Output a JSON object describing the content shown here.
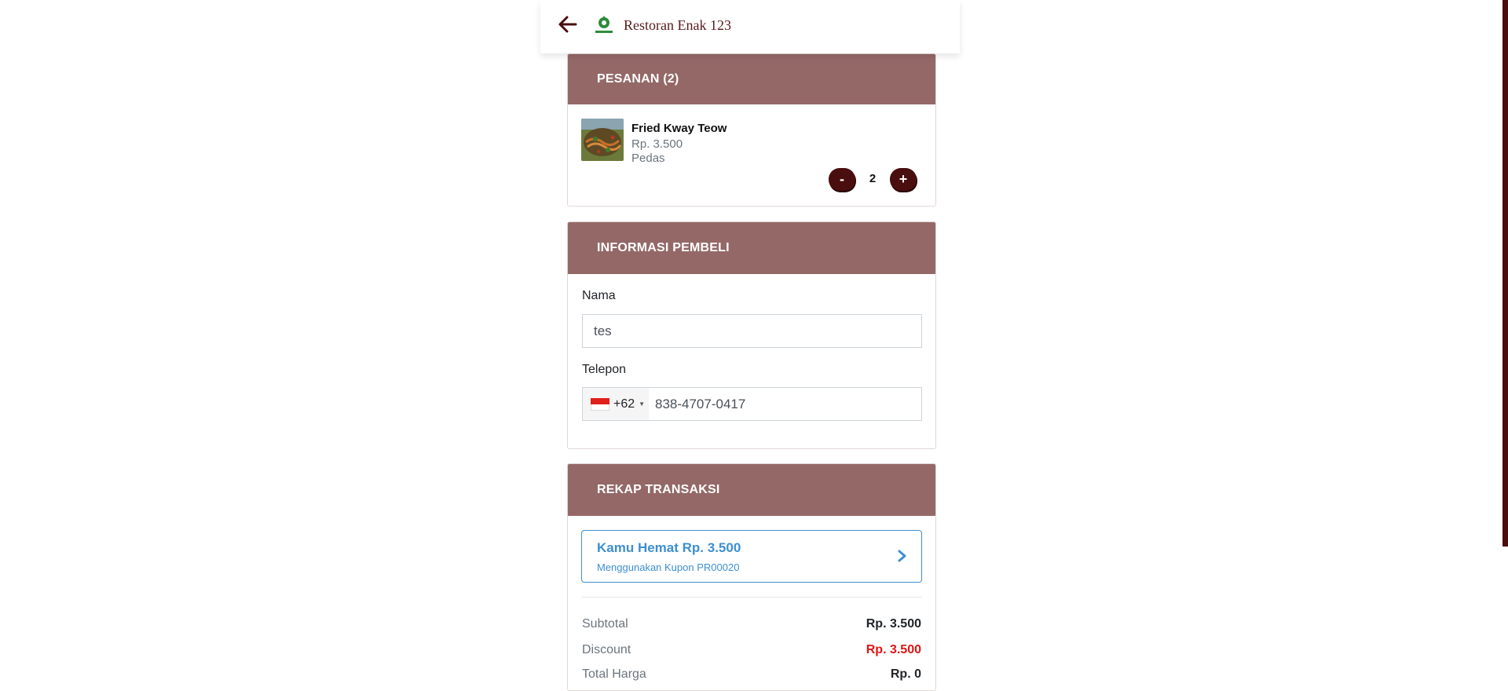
{
  "header": {
    "store_name": "Restoran Enak 123",
    "back_icon": "arrow-left-icon",
    "logo_icon": "restaurant-logo-icon"
  },
  "order": {
    "title": "PESANAN (2)",
    "items": [
      {
        "name": "Fried Kway Teow",
        "price": "Rp. 3.500",
        "note": "Pedas",
        "quantity": "2",
        "minus_label": "-",
        "plus_label": "+"
      }
    ]
  },
  "buyer": {
    "title": "INFORMASI PEMBELI",
    "name_label": "Nama",
    "name_value": "tes",
    "phone_label": "Telepon",
    "phone_prefix": "+62",
    "phone_value": "838-4707-0417",
    "flag_icon": "indonesia-flag-icon"
  },
  "recap": {
    "title": "REKAP TRANSAKSI",
    "coupon_title": "Kamu Hemat Rp. 3.500",
    "coupon_subtitle": "Menggunakan Kupon PR00020",
    "rows": [
      {
        "label": "Subtotal",
        "value": "Rp. 3.500"
      },
      {
        "label": "Discount",
        "value": "Rp. 3.500"
      },
      {
        "label": "Total Harga",
        "value": "Rp. 0"
      }
    ]
  },
  "colors": {
    "header_bg": "#956868",
    "accent_dark": "#4a0e0e",
    "coupon_blue": "#3d8fd1",
    "discount_red": "#e01515"
  }
}
